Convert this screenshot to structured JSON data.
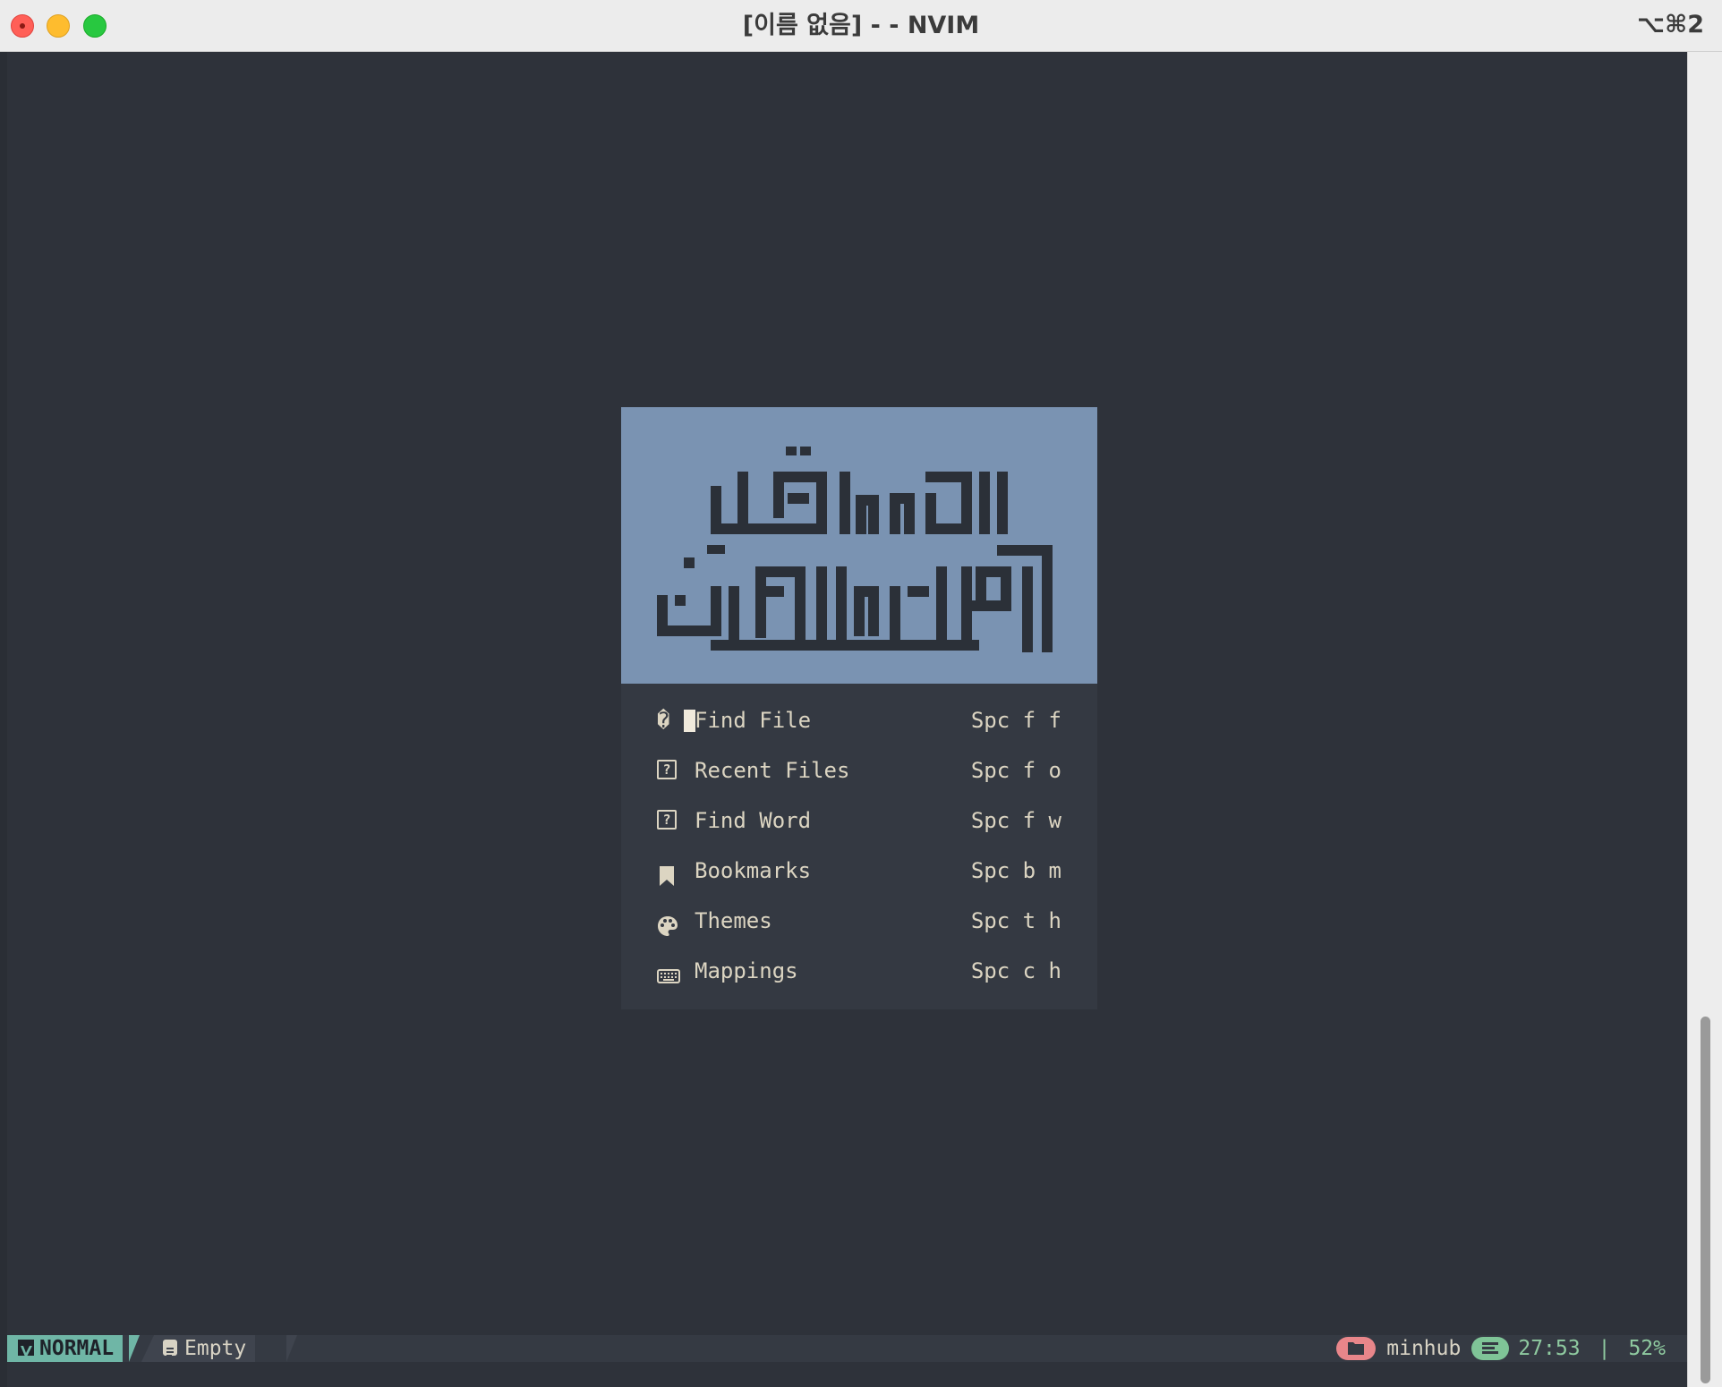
{
  "window": {
    "title": "[이름 없음] - - NVIM",
    "shortcut": "⌥⌘2"
  },
  "dashboard": {
    "banner_glyph_name": "arabic-kufic-calligraphy-logo",
    "menu": [
      {
        "icon": "search-icon",
        "icon_glyph": "�",
        "label": "Find File",
        "key": "Spc f f"
      },
      {
        "icon": "unknown-glyph-icon",
        "icon_glyph": "?",
        "label": "Recent Files",
        "key": "Spc f o"
      },
      {
        "icon": "unknown-glyph-icon",
        "icon_glyph": "?",
        "label": "Find Word",
        "key": "Spc f w"
      },
      {
        "icon": "bookmark-icon",
        "label": "Bookmarks",
        "key": "Spc b m"
      },
      {
        "icon": "palette-icon",
        "label": "Themes",
        "key": "Spc t h"
      },
      {
        "icon": "keyboard-icon",
        "label": "Mappings",
        "key": "Spc c h"
      }
    ]
  },
  "statusline": {
    "mode": "NORMAL",
    "file": "Empty",
    "cwd": "minhub",
    "position": "27:53",
    "separator": "|",
    "percent": "52%"
  },
  "colors": {
    "editor_bg": "#2e323a",
    "banner_bg": "#7a93b2",
    "menu_bg": "#343942",
    "text": "#dcd5c2",
    "mode_bg": "#6fb6a6",
    "folder_pill": "#e8868a",
    "lines_pill": "#7fc497"
  }
}
